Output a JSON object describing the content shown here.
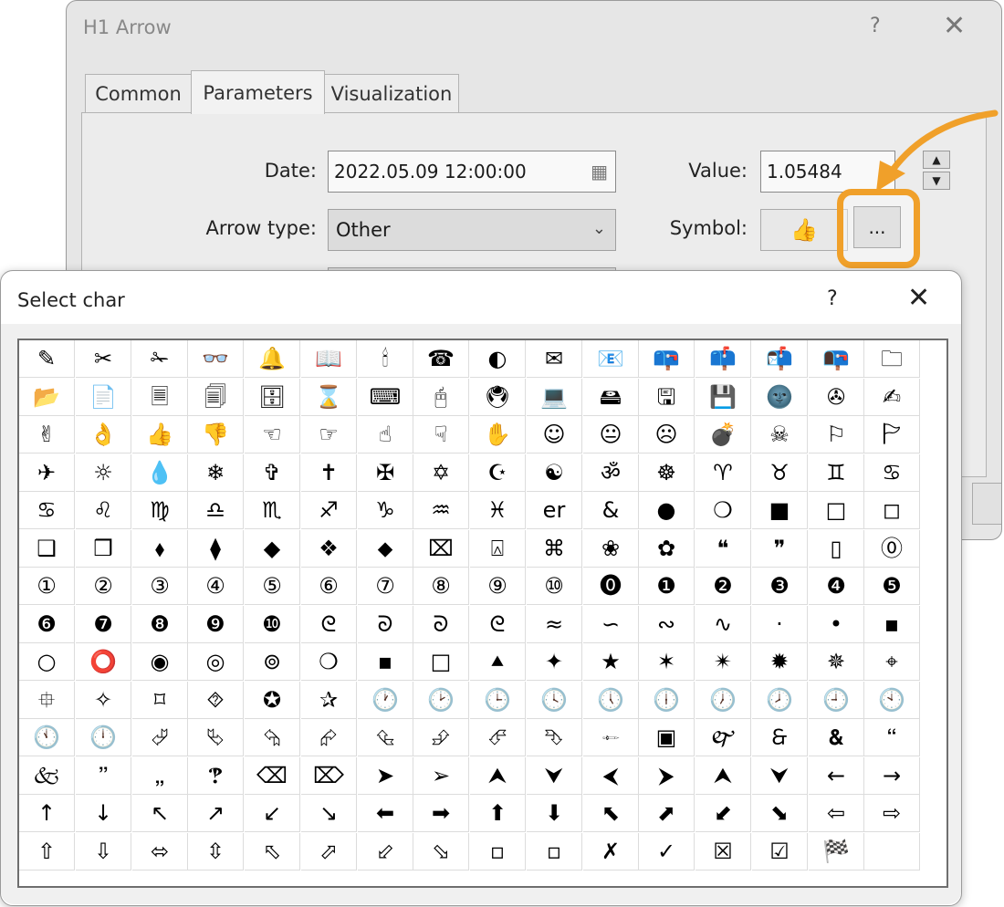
{
  "arrow_dialog": {
    "title": "H1 Arrow",
    "help_label": "?",
    "close_label": "✕",
    "tabs": [
      {
        "label": "Common"
      },
      {
        "label": "Parameters"
      },
      {
        "label": "Visualization"
      }
    ],
    "active_tab": "Parameters",
    "date": {
      "label": "Date:",
      "value": "2022.05.09 12:00:00"
    },
    "arrow_type": {
      "label": "Arrow type:",
      "value": "Other"
    },
    "value": {
      "label": "Value:",
      "value": "1.05484"
    },
    "symbol": {
      "label": "Symbol:",
      "preview_icon": "👍",
      "browse_label": "..."
    },
    "highlight_color": "#f0a02a"
  },
  "select_char_dialog": {
    "title": "Select char",
    "help_label": "?",
    "close_label": "✕",
    "columns": 16,
    "chars": [
      "✎",
      "✂",
      "✁",
      "👓",
      "🔔",
      "📖",
      "🕯",
      "☎",
      "◐",
      "✉",
      "📧",
      "📪",
      "📫",
      "📬",
      "📭",
      "🗀",
      "📂",
      "📄",
      "🗏",
      "🗐",
      "🗄",
      "⌛",
      "⌨",
      "🖰",
      "🖲",
      "💻",
      "🖴",
      "🖫",
      "💾",
      "🌚",
      "✇",
      "✍",
      "✌",
      "👌",
      "👍",
      "👎",
      "☜",
      "☞",
      "☝",
      "☟",
      "✋",
      "☺",
      "😐",
      "☹",
      "💣",
      "☠",
      "⚐",
      "🏱",
      "✈",
      "☼",
      "💧",
      "❄",
      "✞",
      "✝",
      "✠",
      "✡",
      "☪",
      "☯",
      "ॐ",
      "☸",
      "♈",
      "♉",
      "♊",
      "♋",
      "♋",
      "♌",
      "♍",
      "♎",
      "♏",
      "♐",
      "♑",
      "♒",
      "♓",
      "er",
      "&",
      "●",
      "❍",
      "■",
      "□",
      "◻",
      "❑",
      "❒",
      "⬧",
      "⧫",
      "◆",
      "❖",
      "⬥",
      "⌧",
      "⍓",
      "⌘",
      "❀",
      "✿",
      "❝",
      "❞",
      "▯",
      "⓪",
      "①",
      "②",
      "③",
      "④",
      "⑤",
      "⑥",
      "⑦",
      "⑧",
      "⑨",
      "⑩",
      "⓿",
      "❶",
      "❷",
      "❸",
      "❹",
      "❺",
      "❻",
      "❼",
      "❽",
      "❾",
      "❿",
      "ᘓ",
      "ᘐ",
      "ᘐ",
      "ᘓ",
      "≈",
      "∽",
      "∾",
      "∿",
      "·",
      "•",
      "▪",
      "○",
      "⭕",
      "◉",
      "◎",
      "⊚",
      "❍",
      "▪",
      "□",
      "⯅",
      "✦",
      "★",
      "✶",
      "✴",
      "✹",
      "✵",
      "⌖",
      "⯐",
      "✧",
      "⌑",
      "⯑",
      "✪",
      "✰",
      "🕐",
      "🕑",
      "🕒",
      "🕓",
      "🕔",
      "🕕",
      "🕖",
      "🕗",
      "🕘",
      "🕙",
      "🕚",
      "🕛",
      "⮰",
      "⮱",
      "⮲",
      "⮳",
      "⮴",
      "⮵",
      "⮶",
      "⮷",
      "🙮",
      "▣",
      "🙰",
      "🙲",
      "🙴",
      "🙶",
      "🙵",
      "🙷",
      "🙸",
      "🙹",
      "⌫",
      "⌦",
      "➤",
      "➢",
      "⮝",
      "⮟",
      "⮜",
      "⮞",
      "⮝",
      "⮟",
      "←",
      "→",
      "↑",
      "↓",
      "↖",
      "↗",
      "↙",
      "↘",
      "⬅",
      "➡",
      "⬆",
      "⬇",
      "⬉",
      "⬈",
      "⬋",
      "⬊",
      "⇦",
      "⇨",
      "⇧",
      "⇩",
      "⬄",
      "⇳",
      "⬁",
      "⬀",
      "⬃",
      "⬂",
      "▫",
      "▫",
      "✗",
      "✓",
      "☒",
      "☑",
      "🏁",
      ""
    ]
  }
}
